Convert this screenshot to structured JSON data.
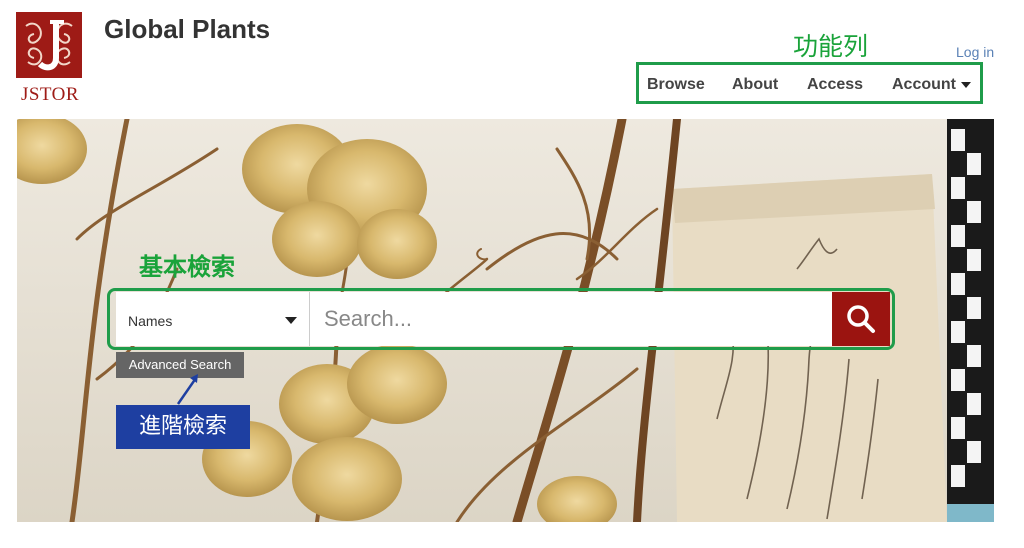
{
  "brand": {
    "logo_text": "JSTOR",
    "site_title": "Global Plants"
  },
  "header": {
    "login_label": "Log in"
  },
  "nav": {
    "items": [
      {
        "label": "Browse"
      },
      {
        "label": "About"
      },
      {
        "label": "Access"
      },
      {
        "label": "Account"
      }
    ]
  },
  "search": {
    "selected_field": "Names",
    "placeholder": "Search...",
    "advanced_label": "Advanced Search"
  },
  "annotations": {
    "nav_label": "功能列",
    "basic_search_label": "基本檢索",
    "advanced_search_label": "進階檢索"
  },
  "colors": {
    "brand_red": "#9e1b16",
    "search_button": "#9b1410",
    "annotation_green": "#1aa33a",
    "annotation_blue": "#1e3fa1"
  },
  "icons": {
    "search_button_icon": "search-icon",
    "account_dropdown": "caret-down-icon"
  }
}
